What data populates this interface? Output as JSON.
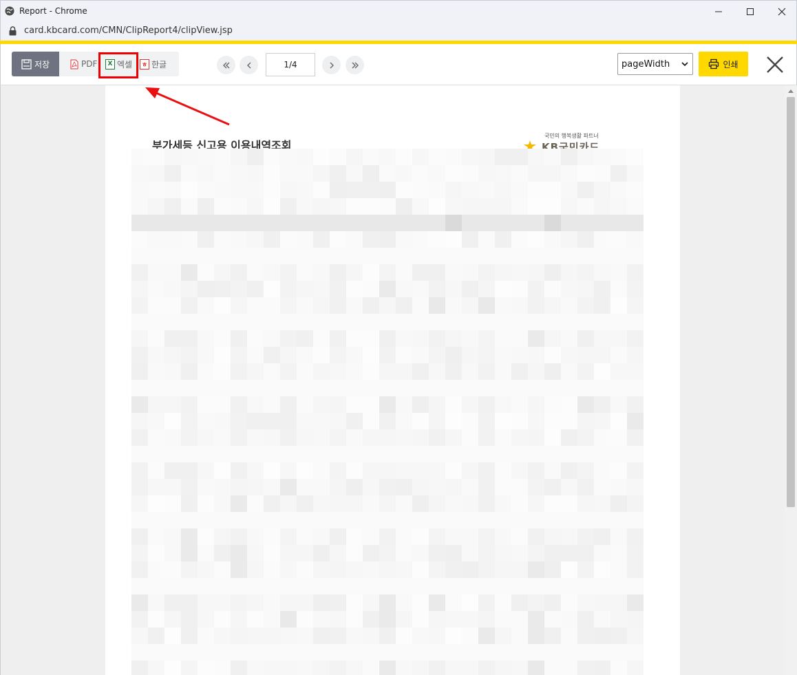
{
  "window": {
    "title": "Report - Chrome",
    "url": "card.kbcard.com/CMN/ClipReport4/clipView.jsp"
  },
  "toolbar": {
    "save_label": "저장",
    "export": [
      {
        "label": "PDF",
        "icon": "pdf-icon"
      },
      {
        "label": "엑셀",
        "icon": "excel-icon"
      },
      {
        "label": "한글",
        "icon": "hwp-icon"
      }
    ],
    "page_indicator": "1/4",
    "zoom_value": "pageWidth",
    "print_label": "인쇄"
  },
  "document": {
    "title": "부가세등 신고용 이용내역조회",
    "logo_tagline": "국민의 행복생활 파트너",
    "logo_brand": "KB국민카드"
  },
  "colors": {
    "accent": "#ffd800",
    "highlight": "#ee0000",
    "save_button": "#6f7280"
  }
}
